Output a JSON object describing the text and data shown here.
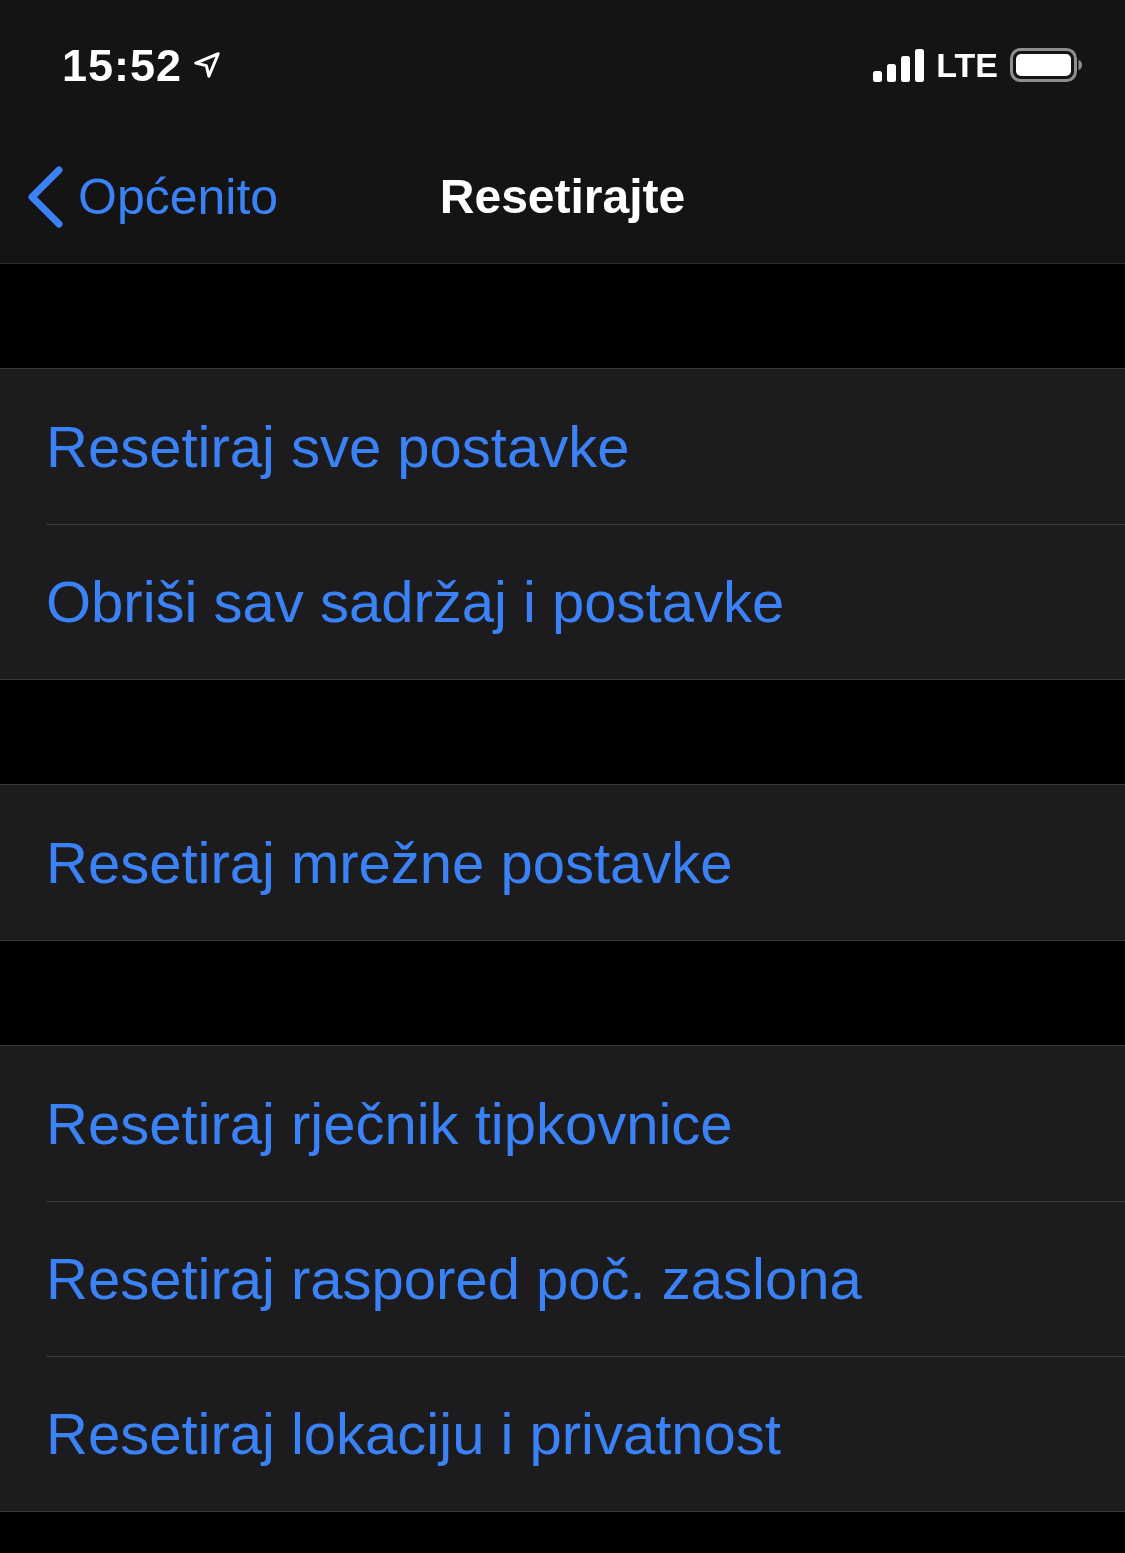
{
  "status_bar": {
    "time": "15:52",
    "network": "LTE"
  },
  "nav_bar": {
    "back": "Općenito",
    "title": "Resetirajte"
  },
  "groups": [
    {
      "items": [
        "Resetiraj sve postavke",
        "Obriši sav sadržaj i postavke"
      ]
    },
    {
      "items": [
        "Resetiraj mrežne postavke"
      ]
    },
    {
      "items": [
        "Resetiraj rječnik tipkovnice",
        "Resetiraj raspored poč. zaslona",
        "Resetiraj lokaciju i privatnost"
      ]
    }
  ]
}
